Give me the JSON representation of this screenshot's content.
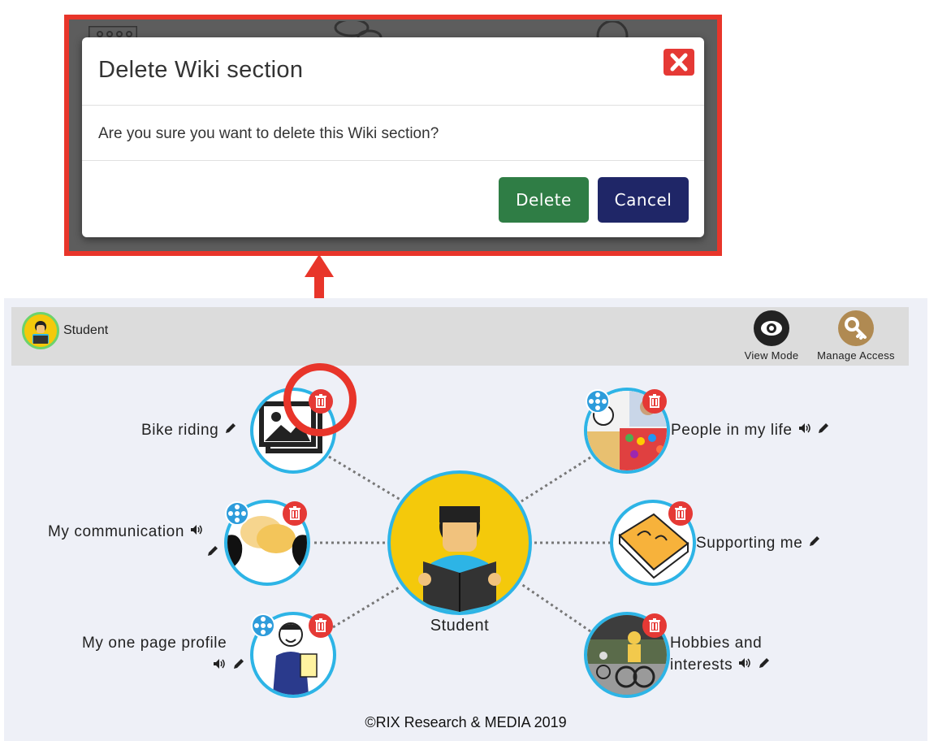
{
  "dialog": {
    "title": "Delete Wiki section",
    "close_icon": "close-icon",
    "message": "Are you sure you want to delete this Wiki section?",
    "delete_label": "Delete",
    "cancel_label": "Cancel",
    "colors": {
      "callout": "#e8352a",
      "delete": "#2f7d45",
      "cancel": "#1f2667",
      "close": "#e53935"
    }
  },
  "topbar": {
    "user_name": "Student",
    "view_mode_label": "View Mode",
    "manage_access_label": "Manage Access"
  },
  "mindmap": {
    "center_label": "Student",
    "nodes": [
      {
        "label": "Bike riding",
        "icons": [
          "pencil-icon"
        ]
      },
      {
        "label": "My communication",
        "icons": [
          "speaker-icon",
          "pencil-icon"
        ]
      },
      {
        "label": "My one page profile",
        "icons": [
          "speaker-icon",
          "pencil-icon"
        ]
      },
      {
        "label": "People in my life",
        "icons": [
          "speaker-icon",
          "pencil-icon"
        ]
      },
      {
        "label": "Supporting me",
        "icons": [
          "pencil-icon"
        ]
      },
      {
        "label": "Hobbies and",
        "label2": "interests",
        "icons": [
          "speaker-icon",
          "pencil-icon"
        ]
      }
    ]
  },
  "footer": "©RIX  Research & MEDIA 2019",
  "colors": {
    "node_border": "#2db4e6",
    "trash": "#e53935",
    "share": "#2d9cdb",
    "center_bg": "#f4c90b"
  }
}
